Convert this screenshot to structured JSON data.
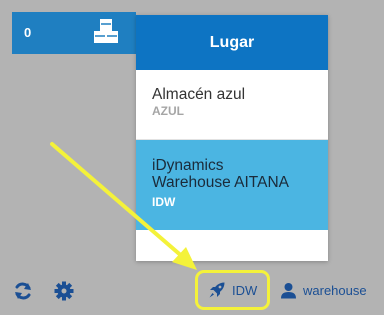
{
  "tile": {
    "count": "0",
    "icon": "cubes-icon"
  },
  "popup": {
    "title": "Lugar",
    "warehouses": [
      {
        "name": "Almacén azul",
        "code": "AZUL"
      },
      {
        "name_line1": "iDynamics",
        "name_line2": "Warehouse AITANA",
        "code": "IDW",
        "selected": true
      }
    ]
  },
  "footer": {
    "warehouse_label": "IDW",
    "user_label": "warehouse"
  },
  "colors": {
    "header": "#0d74c3",
    "selected": "#4bb5e2",
    "highlight": "#f4f23a"
  }
}
